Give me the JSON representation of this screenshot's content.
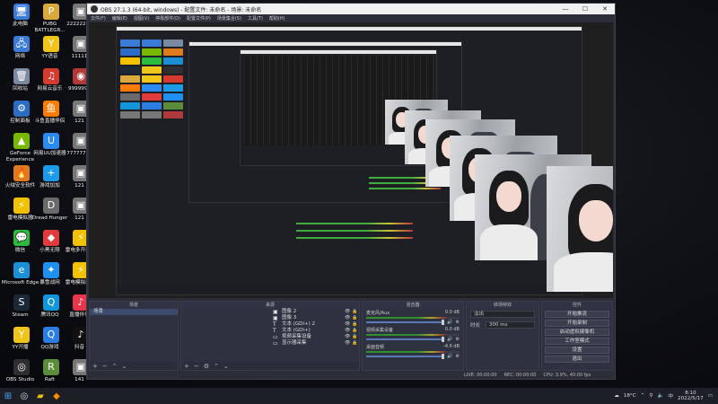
{
  "desktop": {
    "icons": [
      {
        "label": "此电脑",
        "glyph": "🖥",
        "color": "#3b7bd8"
      },
      {
        "label": "网络",
        "glyph": "🖧",
        "color": "#3b7bd8"
      },
      {
        "label": "回收站",
        "glyph": "🗑",
        "color": "#7a8aa0"
      },
      {
        "label": "控制面板",
        "glyph": "⚙",
        "color": "#2b6cc4"
      },
      {
        "label": "GeForce Experience",
        "glyph": "▲",
        "color": "#76b900"
      },
      {
        "label": "火绒安全软件",
        "glyph": "🔥",
        "color": "#e07a1f"
      },
      {
        "label": "雷电模拟器",
        "glyph": "⚡",
        "color": "#f2c200"
      },
      {
        "label": "微信",
        "glyph": "💬",
        "color": "#2dbb3d"
      },
      {
        "label": "Microsoft Edge",
        "glyph": "e",
        "color": "#1a8fd6"
      },
      {
        "label": "Steam",
        "glyph": "S",
        "color": "#1b2838"
      },
      {
        "label": "YY开播",
        "glyph": "Y",
        "color": "#f0c419"
      },
      {
        "label": "OBS Studio",
        "glyph": "◎",
        "color": "#302e31"
      },
      {
        "label": "PUBG BATTLEGR...",
        "glyph": "P",
        "color": "#d9a93b"
      },
      {
        "label": "YY语音",
        "glyph": "Y",
        "color": "#f0c419"
      },
      {
        "label": "网易云音乐",
        "glyph": "♫",
        "color": "#d53a2f"
      },
      {
        "label": "斗鱼直播伴侣",
        "glyph": "鱼",
        "color": "#ff7b00"
      },
      {
        "label": "网易UU加速器",
        "glyph": "U",
        "color": "#2b8bf2"
      },
      {
        "label": "游戏加加",
        "glyph": "+",
        "color": "#1c9be8"
      },
      {
        "label": "Dread Hunger",
        "glyph": "D",
        "color": "#6a6a6a"
      },
      {
        "label": "小黑无限",
        "glyph": "◆",
        "color": "#e23b3b"
      },
      {
        "label": "暴雪战网",
        "glyph": "✦",
        "color": "#1f8ff0"
      },
      {
        "label": "腾讯QQ",
        "glyph": "Q",
        "color": "#1296db"
      },
      {
        "label": "QQ游戏",
        "glyph": "Q",
        "color": "#2a7de1"
      },
      {
        "label": "Raft",
        "glyph": "R",
        "color": "#5b8c3a"
      },
      {
        "label": "22222222",
        "glyph": "▣",
        "color": "#777"
      },
      {
        "label": "11111",
        "glyph": "▣",
        "color": "#777"
      },
      {
        "label": "9999999",
        "glyph": "◉",
        "color": "#b03a3a"
      },
      {
        "label": "121",
        "glyph": "▣",
        "color": "#777"
      },
      {
        "label": "77777777",
        "glyph": "▣",
        "color": "#777"
      },
      {
        "label": "121",
        "glyph": "▣",
        "color": "#777"
      },
      {
        "label": "121",
        "glyph": "▣",
        "color": "#777"
      },
      {
        "label": "雷电多开器4",
        "glyph": "⚡",
        "color": "#f2c200"
      },
      {
        "label": "雷电模拟器4",
        "glyph": "⚡",
        "color": "#f2c200"
      },
      {
        "label": "直播伴侣",
        "glyph": "♪",
        "color": "#e8354a"
      },
      {
        "label": "抖音",
        "glyph": "♪",
        "color": "#111"
      },
      {
        "label": "141",
        "glyph": "▣",
        "color": "#777"
      }
    ]
  },
  "obs": {
    "title": "OBS 27.1.3 (64-bit, windows) - 配置文件: 未命名 - 场景: 未命名",
    "menu": [
      "文件(F)",
      "编辑(E)",
      "视图(V)",
      "停靠部件(D)",
      "配置文件(P)",
      "场景集合(S)",
      "工具(T)",
      "帮助(H)"
    ],
    "docks": {
      "scenes_header": "场景",
      "sources_header": "来源",
      "mixer_header": "混音器",
      "transitions_header": "转场特效",
      "controls_header": "控件",
      "scenes": [
        "场景"
      ],
      "sources": [
        {
          "icon": "▣",
          "name": "图像 2"
        },
        {
          "icon": "▣",
          "name": "图像 3"
        },
        {
          "icon": "T",
          "name": "文本 (GDI+) 2"
        },
        {
          "icon": "T",
          "name": "文本 (GDI+)"
        },
        {
          "icon": "▭",
          "name": "视频采集设备"
        },
        {
          "icon": "▭",
          "name": "显示器采集"
        }
      ],
      "mixer": [
        {
          "name": "麦克风/Aux",
          "db": "0.0 dB"
        },
        {
          "name": "视频采集设备",
          "db": "0.0 dB"
        },
        {
          "name": "桌面音频",
          "db": "-4.6 dB"
        }
      ],
      "transition": {
        "type_label": "淡出",
        "duration_label": "时长",
        "duration_value": "300 ms"
      },
      "controls": [
        "开始推流",
        "开始录制",
        "启动虚拟摄像机",
        "工作室模式",
        "设置",
        "退出"
      ]
    },
    "status": {
      "live": "LIVE: 00:00:00",
      "rec": "REC: 00:00:00",
      "cpu": "CPU: 3.9%, 40.00 fps"
    },
    "window_buttons": {
      "minimize": "—",
      "maximize": "☐",
      "close": "✕"
    }
  },
  "taskbar": {
    "weather": "18°C",
    "time": "8:10",
    "date": "2022/5/17",
    "ime": "中"
  }
}
